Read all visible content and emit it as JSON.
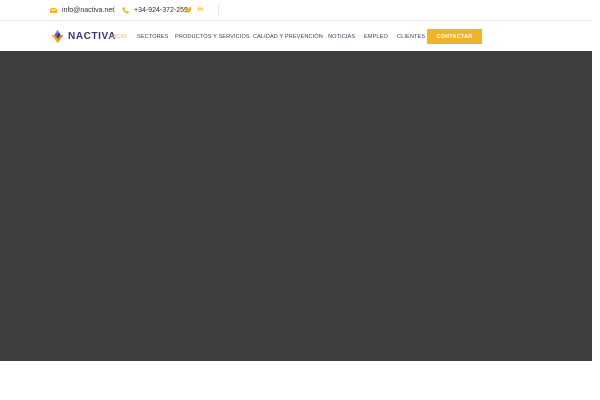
{
  "topbar": {
    "email": "info@nactiva.net",
    "email_icon": "envelope-icon",
    "phone": "+34-924-372-259",
    "phone_icon": "phone-icon",
    "social": [
      {
        "name": "facebook-icon",
        "glyph": "f"
      },
      {
        "name": "twitter-icon",
        "glyph": "🐦"
      },
      {
        "name": "linkedin-icon",
        "glyph": "in"
      }
    ]
  },
  "brand": {
    "name": "NACTIVA",
    "accent": "#f0b429",
    "primary": "#3b3576"
  },
  "nav": {
    "items": [
      {
        "label": "INICIO",
        "active": true
      },
      {
        "label": "SECTORES",
        "active": false
      },
      {
        "label": "PRODUCTOS Y SERVICIOS",
        "active": false
      },
      {
        "label": "CALIDAD Y PREVENCIÓN",
        "active": false
      },
      {
        "label": "NOTICIAS",
        "active": false
      },
      {
        "label": "EMPLEO",
        "active": false
      },
      {
        "label": "CLIENTES",
        "active": false
      }
    ],
    "cta_label": "CONTACTAR"
  },
  "hero": {
    "background": "#3e3e3e"
  }
}
